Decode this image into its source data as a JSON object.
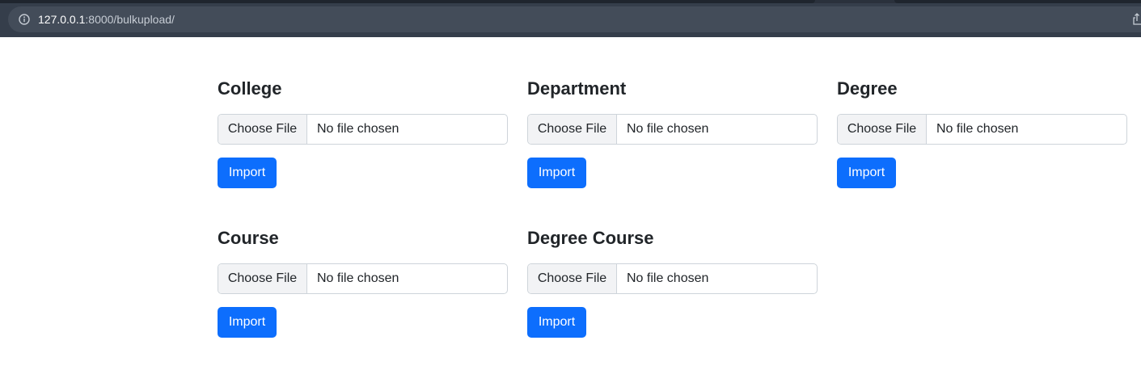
{
  "browser": {
    "url_host": "127.0.0.1",
    "url_rest": ":8000/bulkupload/"
  },
  "sections": [
    {
      "title": "College",
      "choose_label": "Choose File",
      "file_status": "No file chosen",
      "import_label": "Import"
    },
    {
      "title": "Department",
      "choose_label": "Choose File",
      "file_status": "No file chosen",
      "import_label": "Import"
    },
    {
      "title": "Degree",
      "choose_label": "Choose File",
      "file_status": "No file chosen",
      "import_label": "Import"
    },
    {
      "title": "Course",
      "choose_label": "Choose File",
      "file_status": "No file chosen",
      "import_label": "Import"
    },
    {
      "title": "Degree Course",
      "choose_label": "Choose File",
      "file_status": "No file chosen",
      "import_label": "Import"
    }
  ],
  "colors": {
    "primary": "#0d6efd",
    "browser_chrome": "#353e4b",
    "heading": "#212529"
  },
  "icons": {
    "address_bar_left": "info-icon",
    "address_bar_right": "share-icon"
  }
}
